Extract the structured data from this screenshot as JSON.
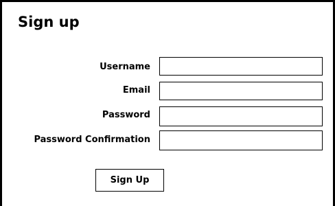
{
  "form": {
    "title": "Sign up",
    "fields": [
      {
        "label": "Username",
        "value": ""
      },
      {
        "label": "Email",
        "value": ""
      },
      {
        "label": "Password",
        "value": ""
      },
      {
        "label": "Password Confirmation",
        "value": ""
      }
    ],
    "submit_label": "Sign Up"
  }
}
